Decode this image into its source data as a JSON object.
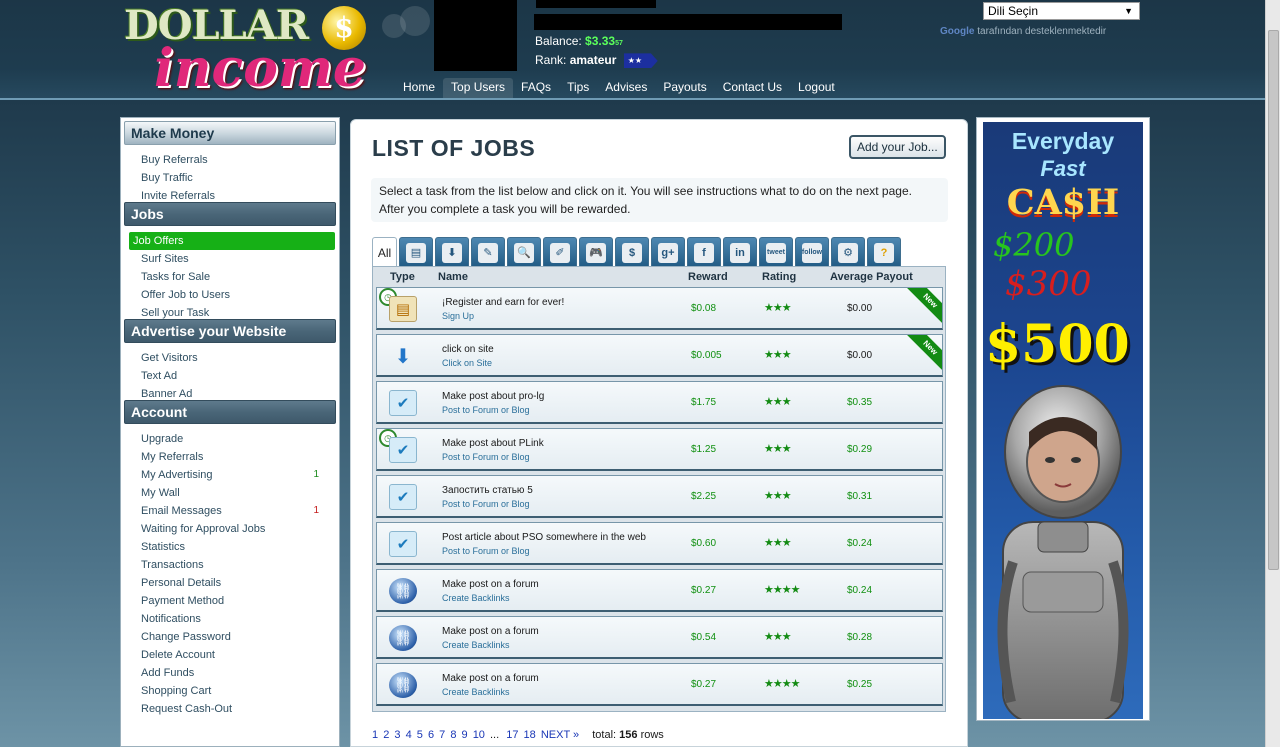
{
  "header": {
    "logo_top": "DOLLAR",
    "logo_coin": "$",
    "logo_bottom": "income",
    "balance_label": "Balance:",
    "balance_value": "$3.33",
    "balance_suffix": "57",
    "rank_label": "Rank:",
    "rank_value": "amateur",
    "rank_badge": "★★",
    "language_select": "Dili Seçin",
    "translate_brand": "Google",
    "translate_text": "tarafından desteklenmektedir",
    "nav": [
      {
        "label": "Home"
      },
      {
        "label": "Top Users"
      },
      {
        "label": "FAQs"
      },
      {
        "label": "Tips"
      },
      {
        "label": "Advises"
      },
      {
        "label": "Payouts"
      },
      {
        "label": "Contact Us"
      },
      {
        "label": "Logout"
      }
    ]
  },
  "sidebar": {
    "sections": [
      {
        "title": "Make Money",
        "items": [
          "Buy Referrals",
          "Buy Traffic",
          "Invite Referrals"
        ]
      },
      {
        "title": "Jobs",
        "items": [
          "Job Offers",
          "Surf Sites",
          "Tasks for Sale",
          "Offer Job to Users",
          "Sell your Task"
        ]
      },
      {
        "title": "Advertise your Website",
        "items": [
          "Get Visitors",
          "Text Ad",
          "Banner Ad"
        ]
      },
      {
        "title": "Account",
        "items": [
          "Upgrade",
          "My Referrals",
          "My Advertising",
          "My Wall",
          "Email Messages",
          "Waiting for Approval Jobs",
          "Statistics",
          "Transactions",
          "Personal Details",
          "Payment Method",
          "Notifications",
          "Change Password",
          "Delete Account",
          "Add Funds",
          "Shopping Cart",
          "Request Cash-Out"
        ]
      }
    ],
    "counts": {
      "my_advertising": "1",
      "email_messages": "1"
    }
  },
  "main": {
    "title": "LIST OF JOBS",
    "add_job": "Add your Job...",
    "info_line1": "Select a task from the list below and click on it. You will see instructions what to do on the next page.",
    "info_line2": "After you complete a task you will be rewarded.",
    "tab_all": "All",
    "tab_icons": [
      "register-icon",
      "click-icon",
      "post-icon",
      "search-icon",
      "tools-icon",
      "game-icon",
      "money-icon",
      "google-plus-icon",
      "facebook-icon",
      "linkedin-icon",
      "twitter-tweet-icon",
      "twitter-follow-icon",
      "settings-icon",
      "help-icon"
    ],
    "tab_glyphs": [
      "▤",
      "⬇",
      "✎",
      "🔍",
      "✐",
      "🎮",
      "$",
      "g+",
      "f",
      "in",
      "tweet",
      "follow",
      "⚙",
      "?"
    ],
    "columns": {
      "type": "Type",
      "name": "Name",
      "reward": "Reward",
      "rating": "Rating",
      "avg": "Average Payout"
    },
    "new_label": "New",
    "jobs": [
      {
        "name": "¡Register and earn for ever!",
        "sub": "Sign Up",
        "reward": "$0.08",
        "rating": "★★★",
        "avg": "$0.00"
      },
      {
        "name": "click on site",
        "sub": "Click on Site",
        "reward": "$0.005",
        "rating": "★★★",
        "avg": "$0.00"
      },
      {
        "name": "Make post about pro-lg",
        "sub": "Post to Forum or Blog",
        "reward": "$1.75",
        "rating": "★★★",
        "avg": "$0.35"
      },
      {
        "name": "Make post about PLink",
        "sub": "Post to Forum or Blog",
        "reward": "$1.25",
        "rating": "★★★",
        "avg": "$0.29"
      },
      {
        "name": "Запостить статью 5",
        "sub": "Post to Forum or Blog",
        "reward": "$2.25",
        "rating": "★★★",
        "avg": "$0.31"
      },
      {
        "name": "Post article about PSO somewhere in the web",
        "sub": "Post to Forum or Blog",
        "reward": "$0.60",
        "rating": "★★★",
        "avg": "$0.24"
      },
      {
        "name": "Make post on a forum",
        "sub": "Create Backlinks",
        "reward": "$0.27",
        "rating": "★★★★",
        "avg": "$0.24"
      },
      {
        "name": "Make post on a forum",
        "sub": "Create Backlinks",
        "reward": "$0.54",
        "rating": "★★★",
        "avg": "$0.28"
      },
      {
        "name": "Make post on a forum",
        "sub": "Create Backlinks",
        "reward": "$0.27",
        "rating": "★★★★",
        "avg": "$0.25"
      }
    ],
    "pager": {
      "pages": [
        "1",
        "2",
        "3",
        "4",
        "5",
        "6",
        "7",
        "8",
        "9",
        "10"
      ],
      "ellipsis": "...",
      "tail_pages": [
        "17",
        "18"
      ],
      "next": "NEXT »",
      "total_label": "total:",
      "total_value": "156",
      "rows_label": "rows"
    }
  },
  "banner": {
    "line1": "Everyday",
    "line2": "Fast",
    "line3": "CA$H",
    "amount1": "$200",
    "amount2": "$300",
    "amount3": "$500"
  }
}
